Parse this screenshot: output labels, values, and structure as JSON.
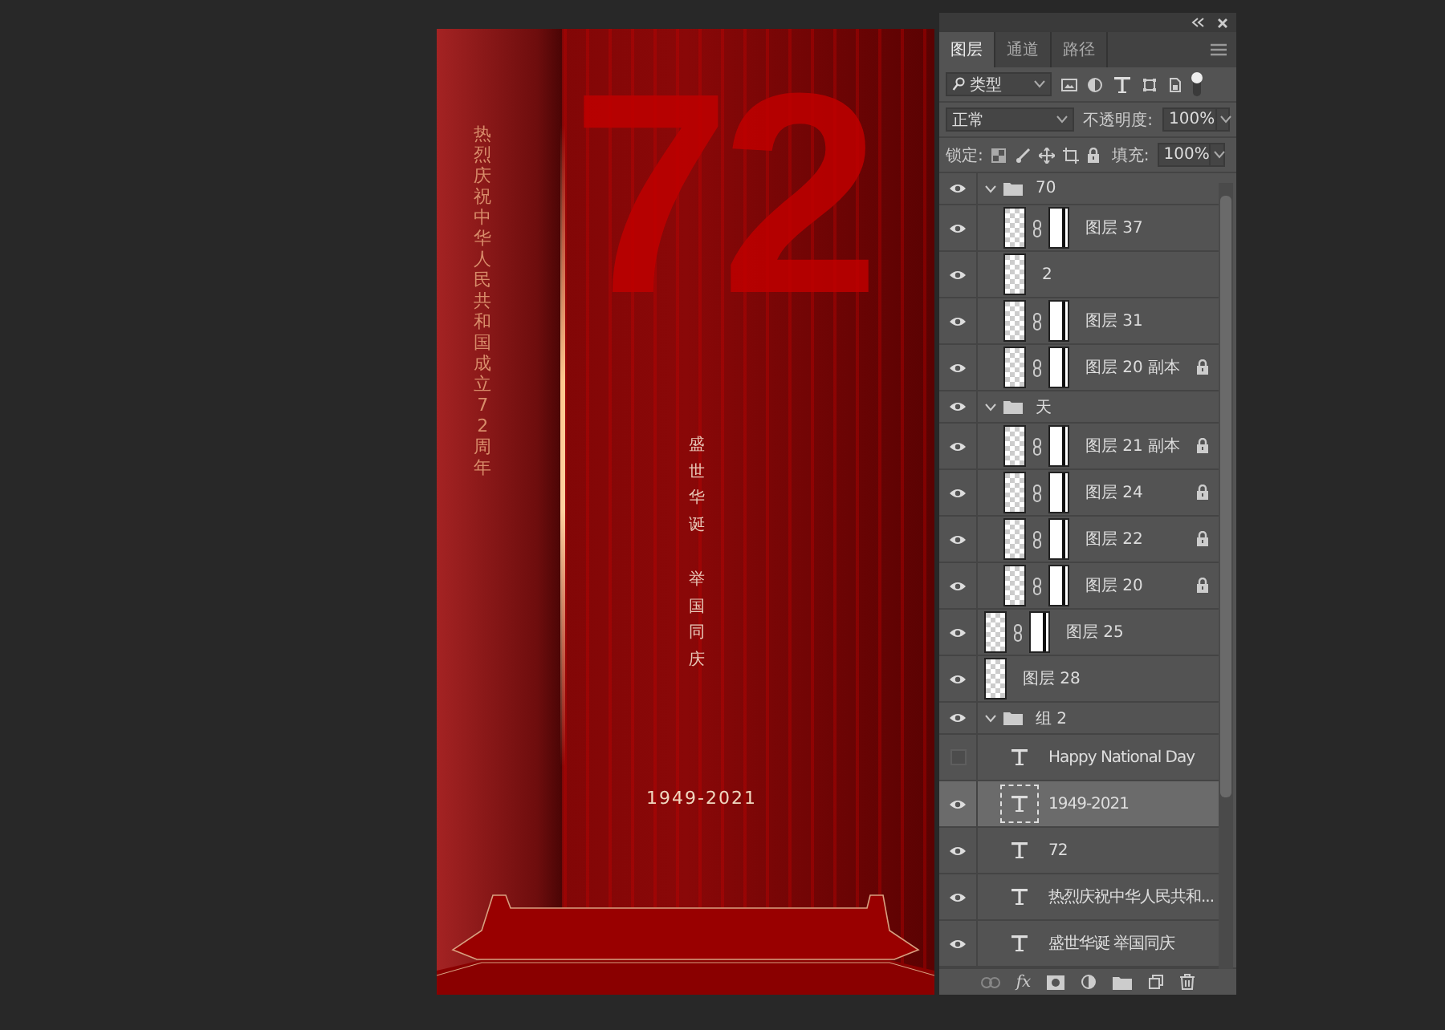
{
  "canvas": {
    "side_text": "热烈庆祝中华人民共和国成立72周年",
    "big_number": "72",
    "slogan": [
      "盛世华诞",
      "举国同庆"
    ],
    "years": "1949-2021"
  },
  "panel": {
    "tabs": [
      {
        "label": "图层",
        "selected": true
      },
      {
        "label": "通道",
        "selected": false
      },
      {
        "label": "路径",
        "selected": false
      }
    ],
    "filter": {
      "value": "类型",
      "enabled": true
    },
    "blend_mode": "正常",
    "opacity_label": "不透明度:",
    "opacity": "100%",
    "lock_label": "锁定:",
    "fill_label": "填充:",
    "fill": "100%",
    "layers": [
      {
        "kind": "group",
        "name": "70",
        "visible": true,
        "selected": false,
        "expanded": true,
        "children": [
          {
            "kind": "layer",
            "name": "图层 37",
            "visible": true,
            "selected": false,
            "locked": false,
            "mask": true
          },
          {
            "kind": "layer",
            "name": "2",
            "visible": true,
            "selected": false,
            "locked": false,
            "mask": false
          },
          {
            "kind": "layer",
            "name": "图层 31",
            "visible": true,
            "selected": false,
            "locked": false,
            "mask": true
          },
          {
            "kind": "layer",
            "name": "图层 20 副本",
            "visible": true,
            "selected": false,
            "locked": true,
            "mask": true
          }
        ]
      },
      {
        "kind": "group",
        "name": "天",
        "visible": true,
        "selected": false,
        "expanded": true,
        "children": [
          {
            "kind": "layer",
            "name": "图层 21 副本",
            "visible": true,
            "selected": false,
            "locked": true,
            "mask": true
          },
          {
            "kind": "layer",
            "name": "图层 24",
            "visible": true,
            "selected": false,
            "locked": true,
            "mask": true
          },
          {
            "kind": "layer",
            "name": "图层 22",
            "visible": true,
            "selected": false,
            "locked": true,
            "mask": true
          },
          {
            "kind": "layer",
            "name": "图层 20",
            "visible": true,
            "selected": false,
            "locked": true,
            "mask": true
          }
        ]
      },
      {
        "kind": "layer",
        "name": "图层 25",
        "visible": true,
        "selected": false,
        "locked": false,
        "mask": true
      },
      {
        "kind": "layer",
        "name": "图层 28",
        "visible": true,
        "selected": false,
        "locked": false,
        "mask": false
      },
      {
        "kind": "group",
        "name": "组 2",
        "visible": true,
        "selected": false,
        "expanded": true,
        "children": [
          {
            "kind": "text",
            "name": "Happy National Day",
            "visible": false,
            "selected": false,
            "locked": false
          },
          {
            "kind": "text",
            "name": "1949-2021",
            "visible": true,
            "selected": true,
            "locked": false
          },
          {
            "kind": "text",
            "name": "72",
            "visible": true,
            "selected": false,
            "locked": false
          },
          {
            "kind": "text",
            "name": "热烈庆祝中华人民共和...",
            "visible": true,
            "selected": false,
            "locked": false
          },
          {
            "kind": "text",
            "name": "盛世华诞  举国同庆",
            "visible": true,
            "selected": false,
            "locked": false
          }
        ]
      }
    ],
    "effects_label": "fx"
  }
}
